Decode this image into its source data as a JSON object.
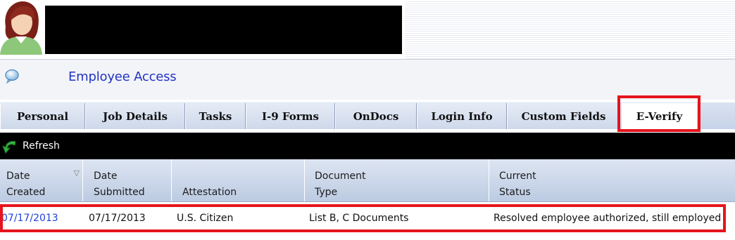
{
  "app": {
    "title": "Employee Access"
  },
  "tabs": [
    {
      "label": "Personal"
    },
    {
      "label": "Job Details"
    },
    {
      "label": "Tasks"
    },
    {
      "label": "I-9 Forms"
    },
    {
      "label": "OnDocs"
    },
    {
      "label": "Login Info"
    },
    {
      "label": "Custom Fields"
    },
    {
      "label": "E-Verify",
      "active": true
    }
  ],
  "toolbar": {
    "refresh_label": "Refresh"
  },
  "grid": {
    "columns": [
      {
        "line1": "Date",
        "line2": "Created",
        "sorted": "descending"
      },
      {
        "line1": "Date",
        "line2": "Submitted"
      },
      {
        "line1": "",
        "line2": "Attestation"
      },
      {
        "line1": "Document",
        "line2": "Type"
      },
      {
        "line1": "Current",
        "line2": "Status"
      }
    ],
    "rows": [
      {
        "date_created": "07/17/2013",
        "date_submitted": "07/17/2013",
        "attestation": "U.S. Citizen",
        "document_type": "List B, C Documents",
        "current_status": "Resolved employee authorized, still employed"
      }
    ]
  },
  "colors": {
    "accent_link": "#1f3fd8",
    "title_blue": "#2233c4",
    "highlight_red": "#e5141d",
    "toolbar_bg": "#000000",
    "tab_bg": "#cdd8ea"
  },
  "icons": {
    "user": "user-avatar-icon",
    "app": "speech-bubble-icon",
    "refresh": "refresh-arrow-icon",
    "sort": "sort-descending-icon"
  }
}
